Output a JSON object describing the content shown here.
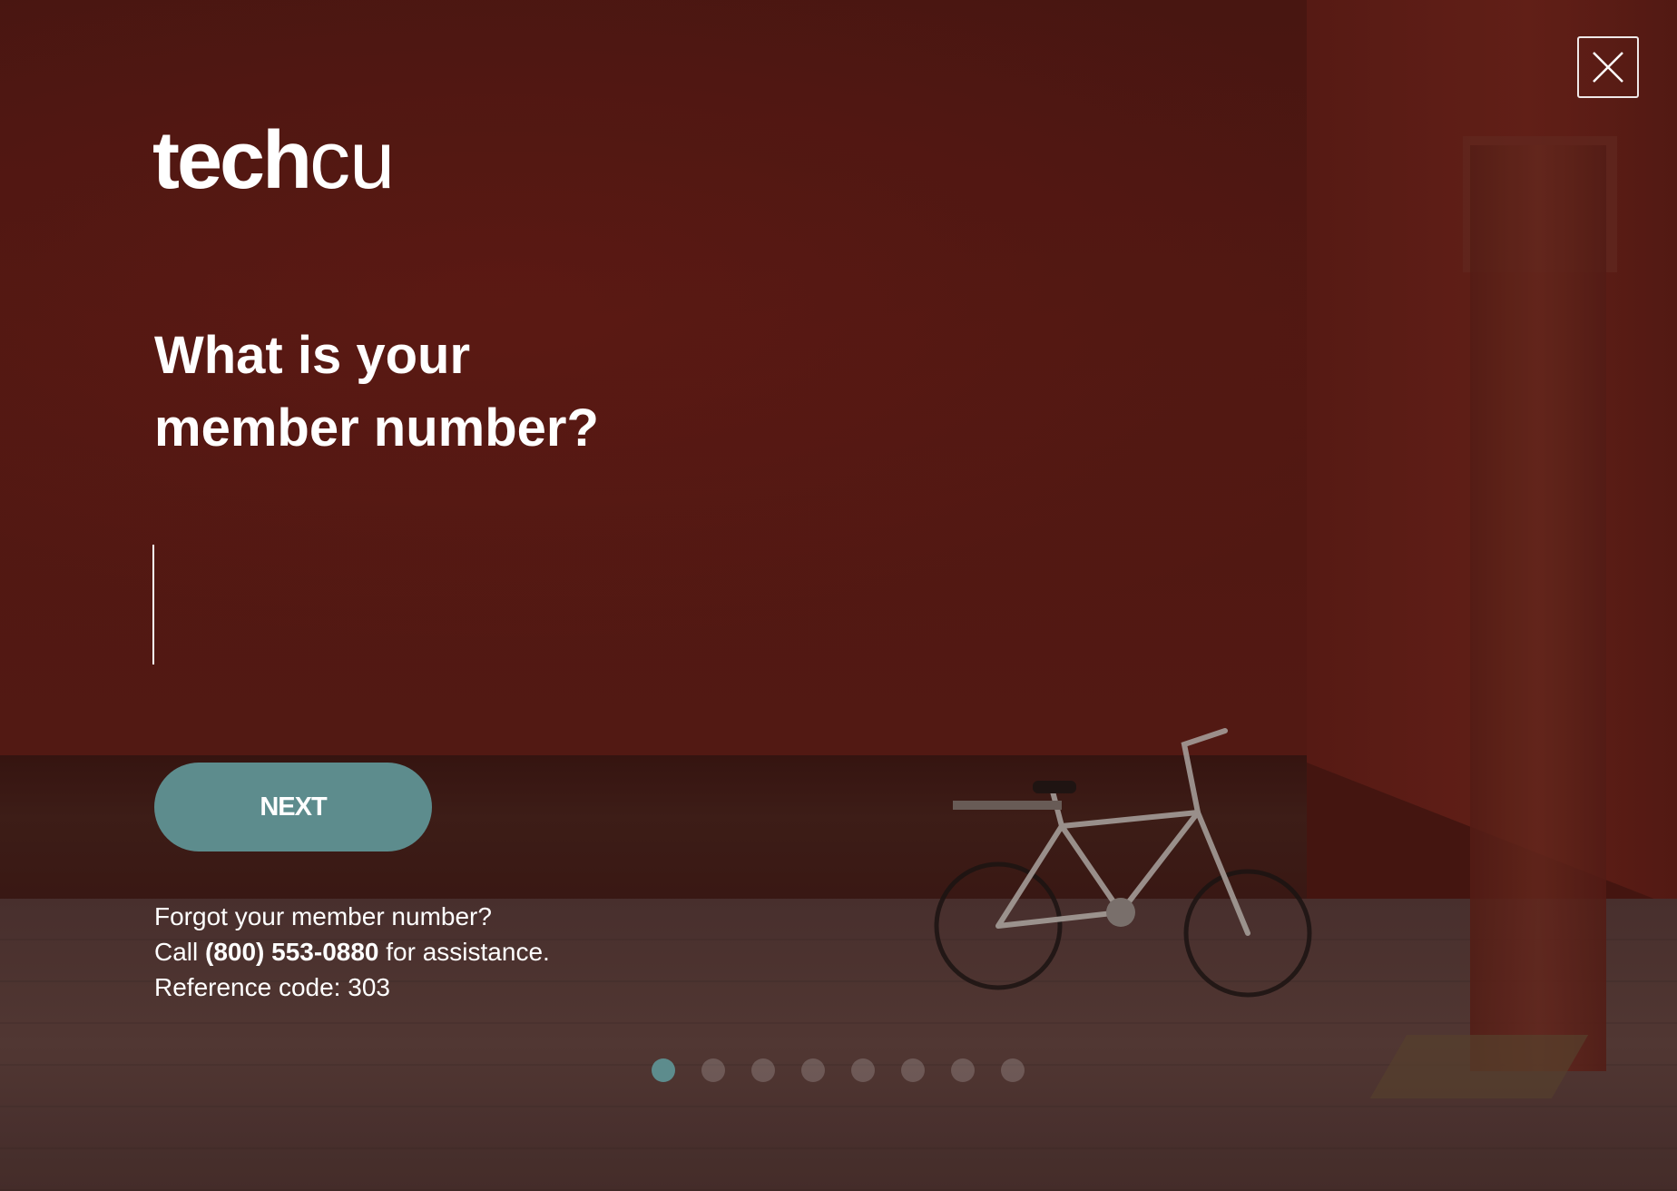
{
  "brand": {
    "logo_bold": "tech",
    "logo_light": "cu"
  },
  "close": {
    "icon": "close-icon"
  },
  "question": {
    "line1": "What is your",
    "line2": "member number?"
  },
  "member_input": {
    "value": "",
    "placeholder": ""
  },
  "next_button": {
    "label": "NEXT"
  },
  "help": {
    "forgot": "Forgot your member number?",
    "call_prefix": "Call ",
    "phone": "(800) 553-0880",
    "call_suffix": " for assistance.",
    "reference": "Reference code: 303"
  },
  "pagination": {
    "total": 8,
    "active_index": 0
  },
  "colors": {
    "accent": "#5d8c8d",
    "background": "#4a1712",
    "text": "#ffffff"
  }
}
